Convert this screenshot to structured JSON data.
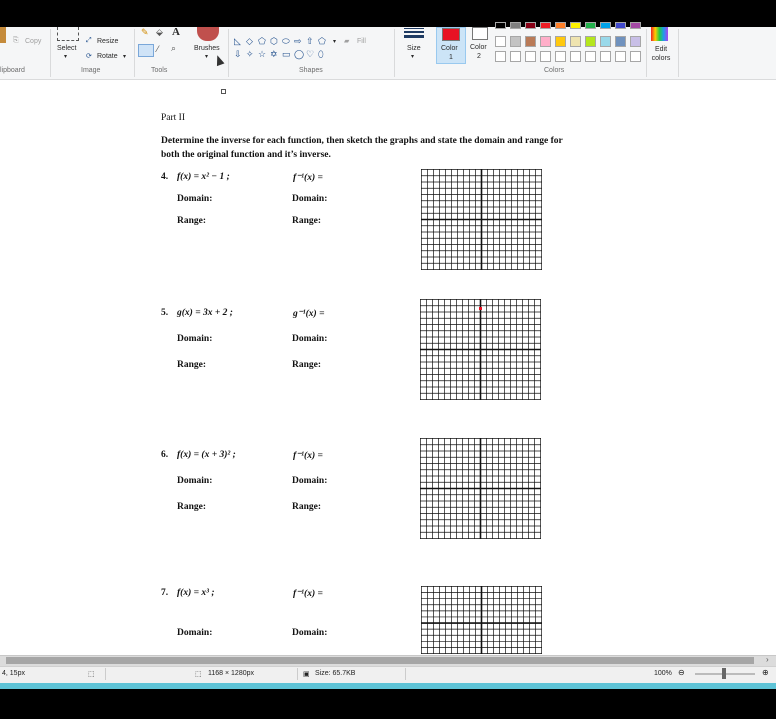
{
  "ribbon": {
    "clipboard": {
      "copy_label": "Copy",
      "group_label": "lipboard"
    },
    "image": {
      "select_label": "Select",
      "resize_label": "Resize",
      "rotate_label": "Rotate",
      "group_label": "Image"
    },
    "tools": {
      "group_label": "Tools"
    },
    "brushes": {
      "label": "Brushes"
    },
    "shapes": {
      "fill_label": "Fill",
      "group_label": "Shapes"
    },
    "size": {
      "label": "Size"
    },
    "color1": {
      "label": "Color",
      "number": "1",
      "color": "#e81123"
    },
    "color2": {
      "label": "Color",
      "number": "2",
      "color": "#ffffff"
    },
    "colors": {
      "group_label": "Colors",
      "edit_label": "Edit colors",
      "palette_row1": [
        "#000000",
        "#7f7f7f",
        "#880015",
        "#ed1c24",
        "#ff7f27",
        "#fff200",
        "#22b14c",
        "#00a2e8",
        "#3f48cc",
        "#a349a4"
      ],
      "palette_row2": [
        "#ffffff",
        "#c3c3c3",
        "#b97a57",
        "#ffaec9",
        "#ffc90e",
        "#efe4b0",
        "#b5e61d",
        "#99d9ea",
        "#7092be",
        "#c8bfe7"
      ],
      "palette_row3": [
        "#ffffff",
        "#ffffff",
        "#ffffff",
        "#ffffff",
        "#ffffff",
        "#ffffff",
        "#ffffff",
        "#ffffff",
        "#ffffff",
        "#ffffff"
      ]
    }
  },
  "document": {
    "part_title": "Part II",
    "instructions_line1": "Determine the inverse for each function, then sketch the graphs and state the domain and range for",
    "instructions_line2": "both the original function and it’s inverse.",
    "problems": [
      {
        "number": "4.",
        "func": "f(x) = x² − 1 ;",
        "inverse": "f⁻¹(x) =",
        "domain": "Domain:",
        "range": "Range:",
        "domain2": "Domain:",
        "range2": "Range:"
      },
      {
        "number": "5.",
        "func": "g(x) = 3x + 2 ;",
        "inverse": "g⁻¹(x) =",
        "domain": "Domain:",
        "range": "Range:",
        "domain2": "Domain:",
        "range2": "Range:"
      },
      {
        "number": "6.",
        "func": "f(x) = (x + 3)² ;",
        "inverse": "f⁻¹(x) =",
        "domain": "Domain:",
        "range": "Range:",
        "domain2": "Domain:",
        "range2": "Range:"
      },
      {
        "number": "7.",
        "func": "f(x) = x³ ;",
        "inverse": "f⁻¹(x) =",
        "domain": "Domain:",
        "domain2": "Domain:"
      }
    ]
  },
  "status": {
    "cursor_pos": "4, 15px",
    "dimensions": "1168 × 1280px",
    "file_size": "Size: 65.7KB",
    "zoom": "100%"
  }
}
